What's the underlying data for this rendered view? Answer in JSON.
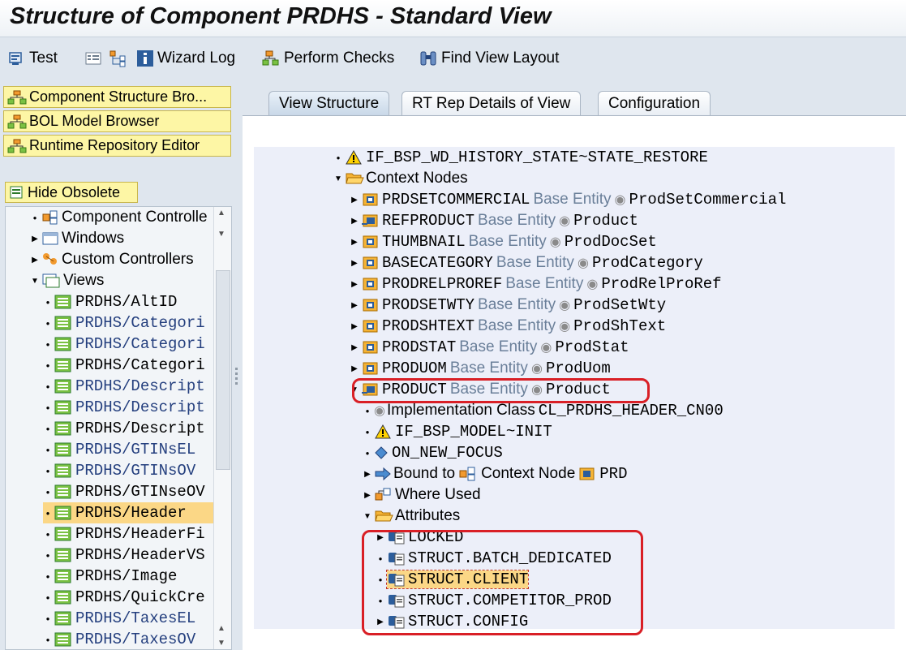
{
  "window": {
    "title": "Structure of Component PRDHS - Standard View"
  },
  "toolbar": {
    "test": "Test",
    "wizard_log": "Wizard Log",
    "perform_checks": "Perform Checks",
    "find_view_layout": "Find View Layout"
  },
  "left": {
    "nav": {
      "component_structure": "Component Structure Bro...",
      "bol_model": "BOL Model Browser",
      "runtime_repo": "Runtime Repository Editor"
    },
    "hide_obsolete": "Hide Obsolete",
    "tree": {
      "component_controller": "Component Controlle",
      "windows": "Windows",
      "custom_controllers": "Custom Controllers",
      "views": "Views",
      "view_items": [
        "PRDHS/AltID",
        "PRDHS/Categori",
        "PRDHS/Categori",
        "PRDHS/Categori",
        "PRDHS/Descript",
        "PRDHS/Descript",
        "PRDHS/Descript",
        "PRDHS/GTINsEL",
        "PRDHS/GTINsOV",
        "PRDHS/GTINseOV",
        "PRDHS/Header",
        "PRDHS/HeaderFi",
        "PRDHS/HeaderVS",
        "PRDHS/Image",
        "PRDHS/QuickCre",
        "PRDHS/TaxesEL",
        "PRDHS/TaxesOV"
      ]
    }
  },
  "tabs": {
    "view_structure": "View Structure",
    "rt_rep_details": "RT Rep Details of View",
    "configuration": "Configuration"
  },
  "structure": {
    "history_restore": "IF_BSP_WD_HISTORY_STATE~STATE_RESTORE",
    "context_nodes": "Context Nodes",
    "base_entity": "Base Entity",
    "nodes": [
      {
        "name": "PRDSETCOMMERCIAL",
        "entity": "ProdSetCommercial"
      },
      {
        "name": "REFPRODUCT",
        "entity": "Product"
      },
      {
        "name": "THUMBNAIL",
        "entity": "ProdDocSet"
      },
      {
        "name": "BASECATEGORY",
        "entity": "ProdCategory"
      },
      {
        "name": "PRODRELPROREF",
        "entity": "ProdRelProRef"
      },
      {
        "name": "PRODSETWTY",
        "entity": "ProdSetWty"
      },
      {
        "name": "PRODSHTEXT",
        "entity": "ProdShText"
      },
      {
        "name": "PRODSTAT",
        "entity": "ProdStat"
      },
      {
        "name": "PRODUOM",
        "entity": "ProdUom"
      }
    ],
    "product": {
      "name": "PRODUCT",
      "entity": "Product"
    },
    "impl_class_label": "Implementation Class",
    "impl_class_value": "CL_PRDHS_HEADER_CN00",
    "model_init": "IF_BSP_MODEL~INIT",
    "on_new_focus": "ON_NEW_FOCUS",
    "bound_to": "Bound to",
    "context_node_label": "Context Node",
    "bound_node": "PRD",
    "where_used": "Where Used",
    "attributes": "Attributes",
    "attr_items": [
      "LOCKED",
      "STRUCT.BATCH_DEDICATED",
      "STRUCT.CLIENT",
      "STRUCT.COMPETITOR_PROD",
      "STRUCT.CONFIG"
    ]
  },
  "colors": {
    "highlight": "#d91f26",
    "nav_button": "#fdf6a5",
    "selection": "#fbd786"
  }
}
